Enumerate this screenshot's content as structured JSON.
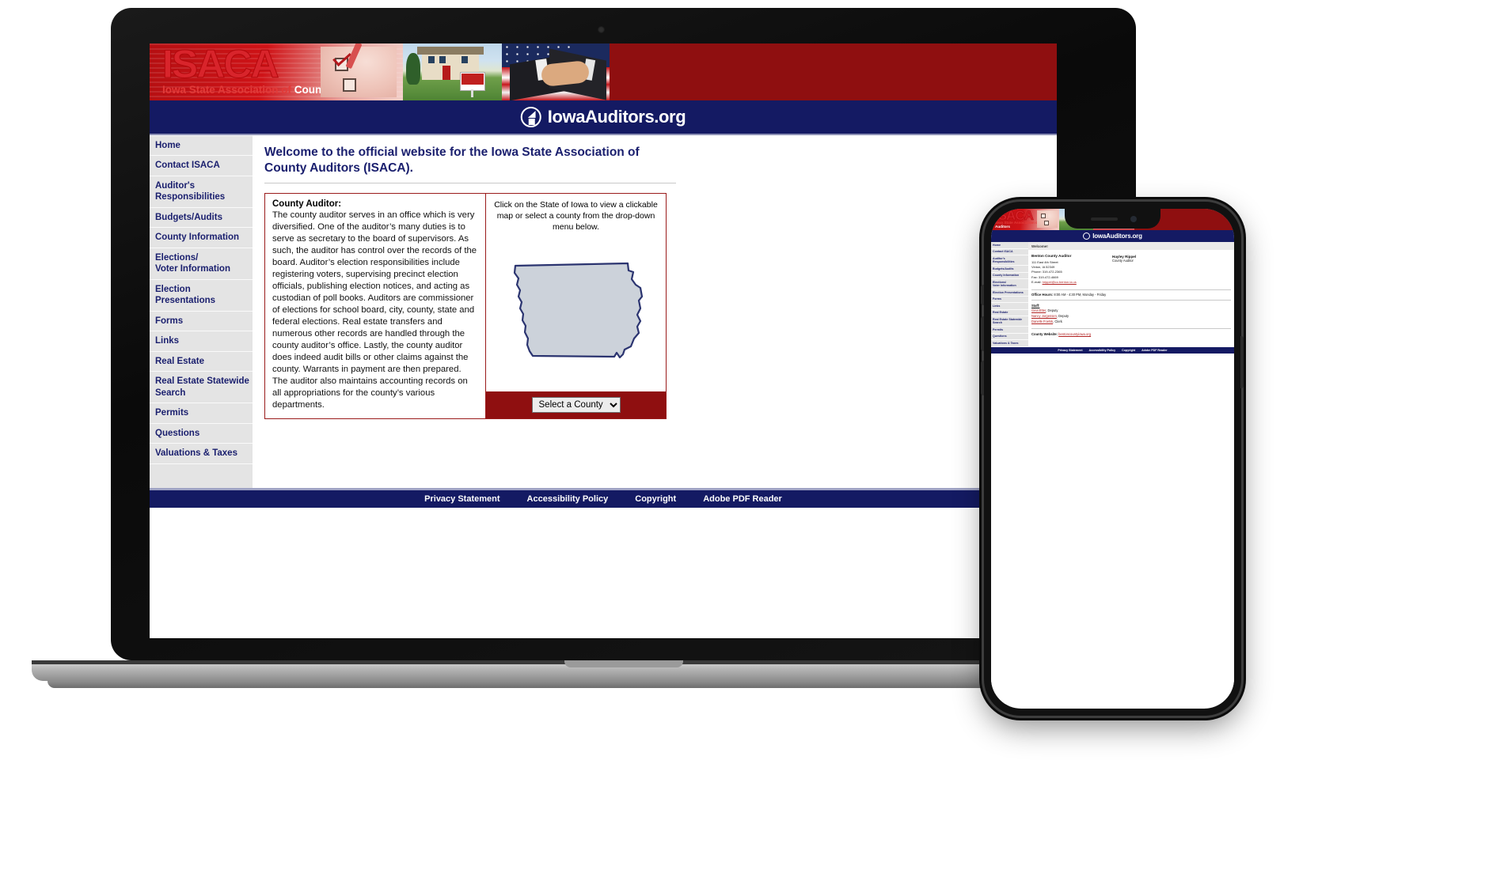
{
  "site": {
    "banner": {
      "logo_text": "ISACA",
      "tagline_red": "Iowa State Association of ",
      "tagline_white": "County Auditors",
      "photos": [
        "ballot-checkbox-photo",
        "house-for-sale-photo",
        "handshake-flag-photo"
      ]
    },
    "brand": {
      "name": "IowaAuditors.org",
      "icon": "iowaauditors-logo-icon"
    },
    "sidebar": {
      "items": [
        {
          "label": "Home"
        },
        {
          "label": "Contact ISACA"
        },
        {
          "label": "Auditor's\nResponsibilities"
        },
        {
          "label": "Budgets/Audits"
        },
        {
          "label": "County Information"
        },
        {
          "label": "Elections/\nVoter Information"
        },
        {
          "label": "Election Presentations"
        },
        {
          "label": "Forms"
        },
        {
          "label": "Links"
        },
        {
          "label": "Real Estate"
        },
        {
          "label": "Real Estate Statewide\nSearch"
        },
        {
          "label": "Permits"
        },
        {
          "label": "Questions"
        },
        {
          "label": "Valuations & Taxes"
        }
      ]
    },
    "main": {
      "page_title": "Welcome to the official website for the Iowa State Association of County Auditors (ISACA).",
      "card": {
        "heading": "County Auditor:",
        "body": "The county auditor serves in an office which is very diversified. One of the auditor’s many duties is to serve as secretary to the board of supervisors. As such, the auditor has control over the records of the board. Auditor’s election responsibilities include registering voters, supervising precinct election officials, publishing election notices, and acting as custodian of poll books. Auditors are commissioner of elections for school board, city, county, state and federal elections. Real estate transfers and numerous other records are handled through the county auditor’s office. Lastly, the county auditor does indeed audit bills or other claims against the county. Warrants in payment are then prepared. The auditor also maintains accounting records on all appropriations for the county’s various departments."
      },
      "map_panel": {
        "hint": "Click on the State of Iowa to view a clickable map or select a county from the drop-down menu below.",
        "map_alt": "iowa-state-map",
        "select_value": "Select a County",
        "select_options": [
          "Select a County"
        ]
      }
    },
    "footer": {
      "links": [
        "Privacy Statement",
        "Accessibility Policy",
        "Copyright",
        "Adobe PDF Reader"
      ]
    }
  },
  "phone": {
    "welcome_bar": "Welcome!",
    "county": {
      "name": "Benton County Auditor",
      "address_line1": "111 East 4th Street",
      "address_line2": "Vinton, IA 52349",
      "phone": "Phone: 319-472-2365",
      "fax": "Fax: 319-472-4669",
      "email_label": "E-mail: ",
      "email": "hrippel@co.benton.ia.us"
    },
    "officer": {
      "name": "Hayley Rippel",
      "title": "County Auditor"
    },
    "office_hours_label": "Office Hours:",
    "office_hours": " 8:00 AM - 4:30 PM, Monday - Friday",
    "staff_label": "Staff:",
    "staff": [
      {
        "name": "Gina Etter",
        "role": ", Deputy"
      },
      {
        "name": "Nancy Jorgensen",
        "role": ", Deputy"
      },
      {
        "name": "Danelle Foelsk",
        "role": ", Clerk"
      }
    ],
    "website_label": "County Website: ",
    "website": "bentoncountyiowa.org",
    "footer_links": [
      "Privacy Statement",
      "Accessibility Policy",
      "Copyright",
      "Adobe PDF Reader"
    ]
  },
  "colors": {
    "navy": "#141a63",
    "red": "#8f0f10",
    "sidebar_bg": "#e4e4e4",
    "map_fill": "#ccd2da"
  }
}
